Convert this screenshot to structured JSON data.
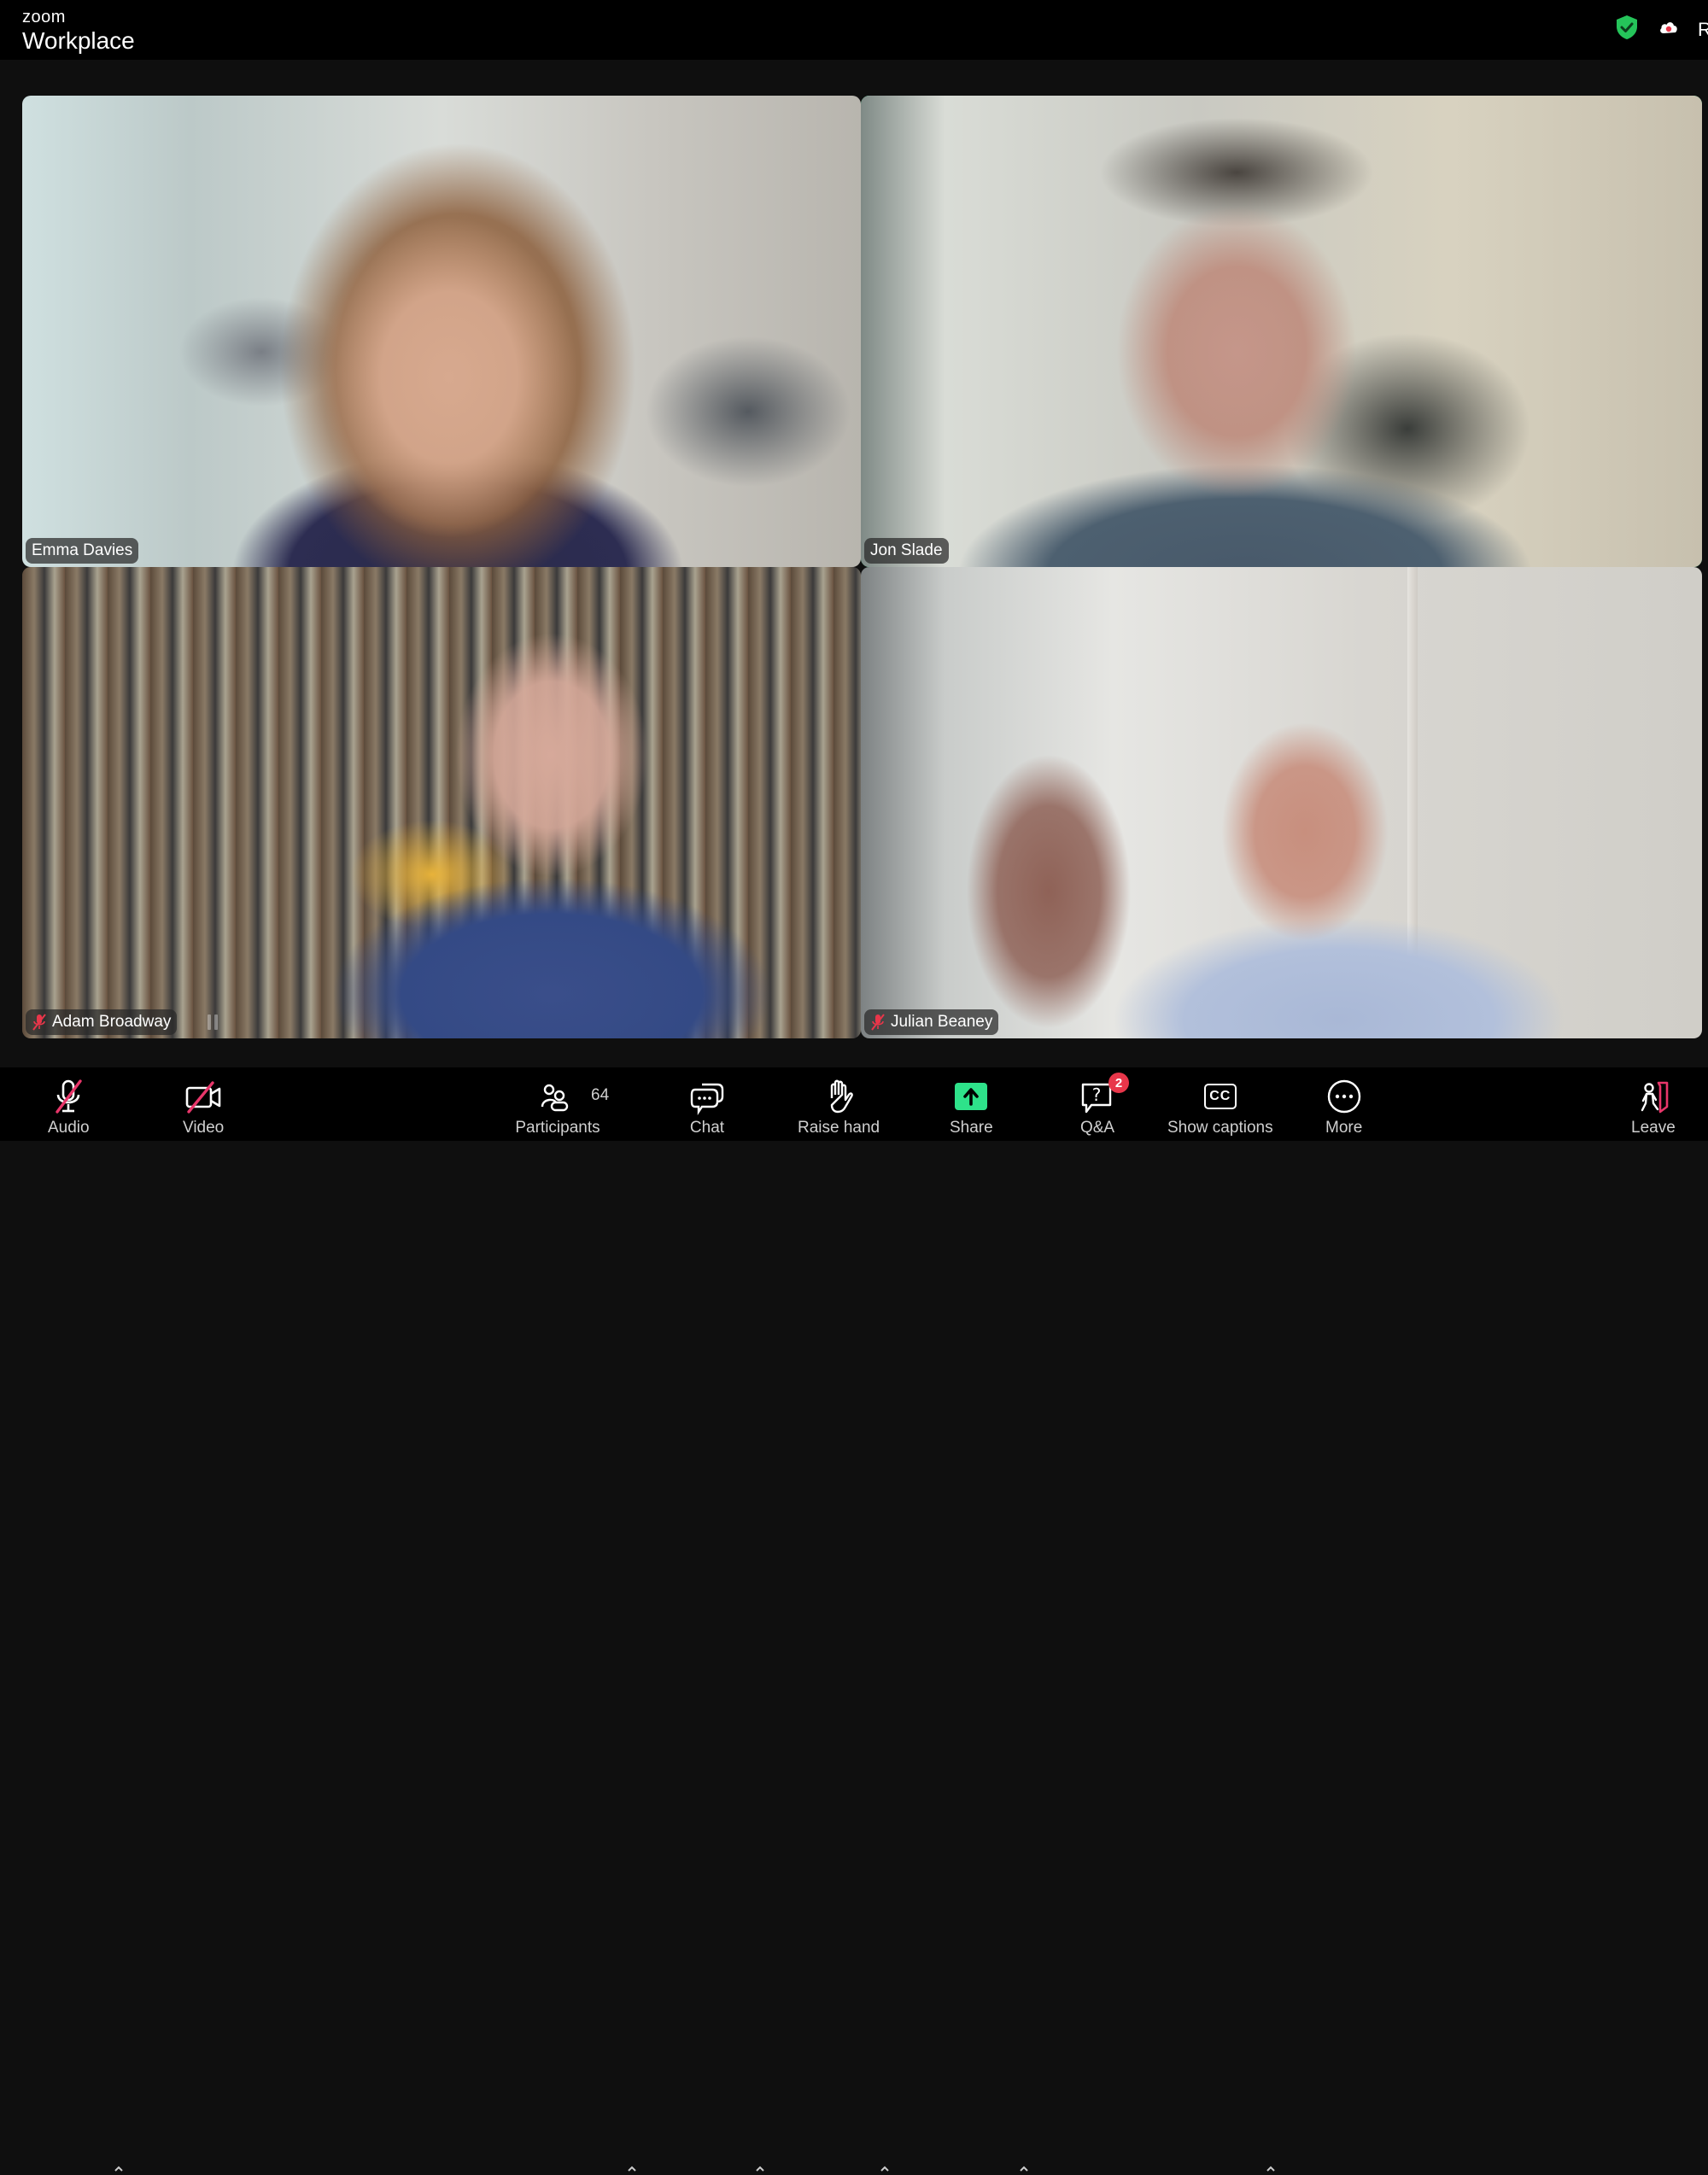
{
  "app": {
    "brand_small": "zoom",
    "brand_big": "Workplace",
    "top_right_text": "R",
    "accent_color": "#2ee28a",
    "muted_color": "#e8364a"
  },
  "gallery": {
    "active_speaker": "Jon Slade",
    "participants": [
      {
        "name": "Emma Davies",
        "muted": false
      },
      {
        "name": "Jon Slade",
        "muted": false,
        "active": true
      },
      {
        "name": "Adam Broadway",
        "muted": true
      },
      {
        "name": "Julian Beaney",
        "muted": true
      }
    ]
  },
  "toolbar": {
    "audio_label": "Audio",
    "video_label": "Video",
    "participants_label": "Participants",
    "participants_count": "64",
    "chat_label": "Chat",
    "raise_hand_label": "Raise hand",
    "share_label": "Share",
    "qa_label": "Q&A",
    "qa_badge": "2",
    "captions_label": "Show captions",
    "captions_icon_text": "CC",
    "more_label": "More",
    "leave_label": "Leave"
  }
}
